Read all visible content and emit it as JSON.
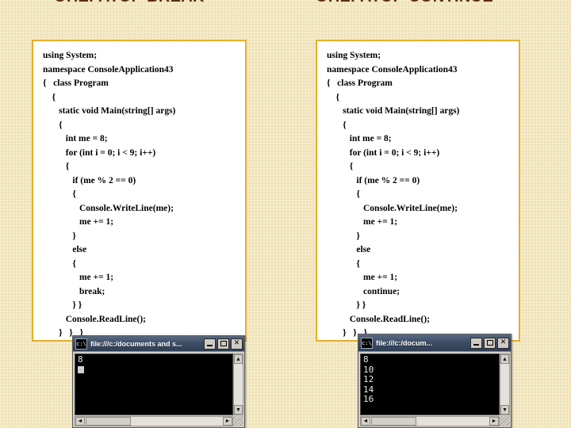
{
  "slide": {
    "background_color": "#f2e7c0",
    "accent_color": "#e8ae2a",
    "title_color": "#5b2d14"
  },
  "left": {
    "title": "ОПЕРАТОР BREAK",
    "code_lines": [
      "using System;",
      "namespace ConsoleApplication43",
      "{   class Program",
      "    {",
      "       static void Main(string[] args)",
      "       {",
      "          int me = 8;",
      "          for (int i = 0; i < 9; i++)",
      "          {",
      "             if (me % 2 == 0)",
      "             {",
      "                Console.WriteLine(me);",
      "                me += 1;",
      "             }",
      "             else",
      "             {",
      "                me += 1;",
      "                break;",
      "             } }",
      "          Console.ReadLine();",
      "       }   }   }"
    ],
    "console": {
      "title": "file:///c:/documents and s...",
      "icon": "console-icon",
      "minimize_label": "minimize",
      "maximize_label": "maximize",
      "close_label": "✕",
      "output_lines": [
        "8"
      ],
      "has_caret": true,
      "scroll_up": "▲",
      "scroll_down": "▼",
      "scroll_left": "◄",
      "scroll_right": "►"
    }
  },
  "right": {
    "title": "ОПЕРАТОР CONTINUE",
    "code_lines": [
      "using System;",
      "namespace ConsoleApplication43",
      "{   class Program",
      "    {",
      "       static void Main(string[] args)",
      "       {",
      "          int me = 8;",
      "          for (int i = 0; i < 9; i++)",
      "          {",
      "             if (me % 2 == 0)",
      "             {",
      "                Console.WriteLine(me);",
      "                me += 1;",
      "             }",
      "             else",
      "             {",
      "                me += 1;",
      "                continue;",
      "             } }",
      "          Console.ReadLine();",
      "       }   }   }"
    ],
    "console": {
      "title": "file:///c:/docum...",
      "icon": "console-icon",
      "minimize_label": "minimize",
      "maximize_label": "maximize",
      "close_label": "✕",
      "output_lines": [
        "8",
        "10",
        "12",
        "14",
        "16"
      ],
      "has_caret": false,
      "scroll_up": "▲",
      "scroll_down": "▼",
      "scroll_left": "◄",
      "scroll_right": "►"
    }
  }
}
